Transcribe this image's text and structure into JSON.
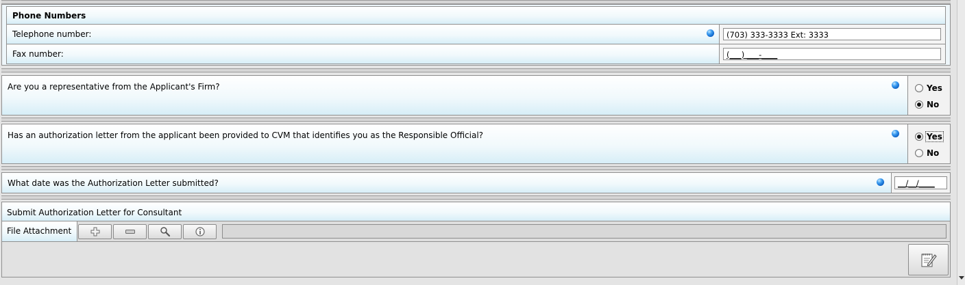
{
  "phone_section": {
    "title": "Phone Numbers",
    "telephone_label": "Telephone number:",
    "telephone_value": "(703) 333-3333 Ext: 3333",
    "fax_label": "Fax number:",
    "fax_value": "(___) ___-____"
  },
  "q_representative": {
    "question": "Are you a representative from the Applicant's Firm?",
    "options": [
      "Yes",
      "No"
    ],
    "selected": "No"
  },
  "q_authorization": {
    "question": "Has an authorization letter from the applicant been provided to CVM that identifies you as the Responsible Official?",
    "options": [
      "Yes",
      "No"
    ],
    "selected": "Yes"
  },
  "q_date": {
    "question": "What date was the Authorization Letter submitted?",
    "value": "__/__/____"
  },
  "attachment": {
    "title": "Submit Authorization Letter for Consultant",
    "label": "File Attachment",
    "buttons": [
      "plus-icon",
      "minus-icon",
      "magnifier-icon",
      "info-icon"
    ]
  },
  "icons": {
    "required": "blue-dot-icon",
    "edit": "notepad-pencil-icon"
  }
}
